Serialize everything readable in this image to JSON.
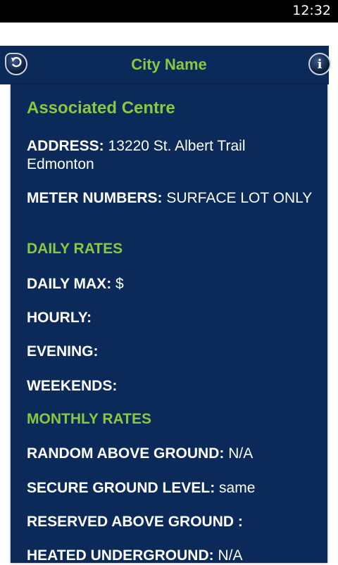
{
  "status": {
    "time": "12:32"
  },
  "header": {
    "title": "City Name",
    "info_glyph": "i"
  },
  "location": {
    "name": "Associated Centre",
    "address_label": "ADDRESS:",
    "address_value": "13220 St. Albert Trail Edmonton",
    "meter_label": "METER NUMBERS:",
    "meter_value": "SURFACE LOT ONLY"
  },
  "daily": {
    "heading": "DAILY RATES",
    "max_label": "DAILY MAX:",
    "max_value": "$",
    "hourly_label": "HOURLY:",
    "hourly_value": "",
    "evening_label": "EVENING:",
    "evening_value": "",
    "weekends_label": "WEEKENDS:",
    "weekends_value": ""
  },
  "monthly": {
    "heading": "MONTHLY RATES",
    "random_label": "RANDOM ABOVE GROUND:",
    "random_value": "N/A",
    "secure_label": "SECURE GROUND LEVEL:",
    "secure_value": "same",
    "reserved_label": "RESERVED ABOVE GROUND :",
    "reserved_value": "",
    "heated_label": "HEATED UNDERGROUND:",
    "heated_value": "N/A"
  },
  "icons": {
    "back": "back-arrow-icon",
    "info": "info-icon"
  },
  "colors": {
    "panel": "#0b2a5a",
    "accent": "#8dc63f",
    "text": "#ffffff"
  }
}
